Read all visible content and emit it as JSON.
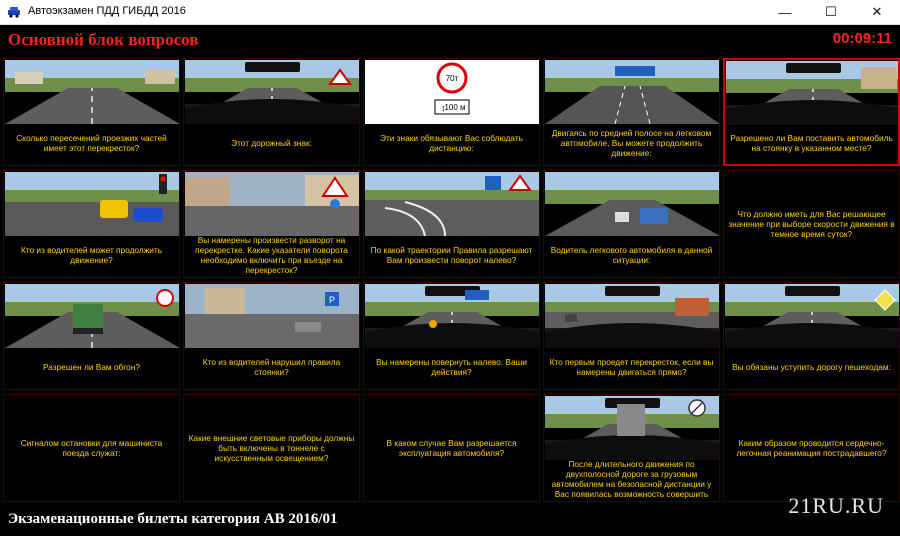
{
  "window": {
    "title": "Автоэкзамен ПДД ГИБДД 2016"
  },
  "header": {
    "title": "Основной блок вопросов",
    "timer": "00:09:11"
  },
  "questions": [
    {
      "text": "Сколько пересечений проезжих частей имеет этот перекресток?",
      "scene": "road"
    },
    {
      "text": "Этот дорожный знак:",
      "scene": "cockpit-sign"
    },
    {
      "text": "Эти знаки обязывают Вас соблюдать дистанцию:",
      "scene": "sign-70t",
      "sign_top": "70т",
      "sign_bottom": "100 м"
    },
    {
      "text": "Двигаясь по средней полосе на легковом автомобиле, Вы можете продолжить движение:",
      "scene": "lanes"
    },
    {
      "text": "Разрешено ли Вам поставить автомобиль на стоянку в указанном месте?",
      "scene": "cockpit-street",
      "active": true
    },
    {
      "text": "Кто из водителей может продолжить движение?",
      "scene": "intersection-cars"
    },
    {
      "text": "Вы намерены произвести разворот на перекрестке. Какие указатели поворота необходимо включить при въезде на перекресток?",
      "scene": "city-roundabout"
    },
    {
      "text": "По какой траектории Правила разрешают Вам произвести поворот налево?",
      "scene": "trajectory"
    },
    {
      "text": "Водитель легкового автомобиля в данной ситуации:",
      "scene": "highway-truck"
    },
    {
      "text": "Что должно иметь для Вас решающее значение при выборе скорости движения в темное время суток?",
      "scene": "none"
    },
    {
      "text": "Разрешен ли Вам обгон?",
      "scene": "truck-overtake"
    },
    {
      "text": "Кто из водителей нарушил правила стоянки?",
      "scene": "parking"
    },
    {
      "text": "Вы намерены повернуть налево. Ваши действия?",
      "scene": "cockpit-left"
    },
    {
      "text": "Кто первым проедет перекресток, если вы намерены двигаться прямо?",
      "scene": "cockpit-crossing"
    },
    {
      "text": "Вы обязаны уступить дорогу пешеходам:",
      "scene": "cockpit-ped"
    },
    {
      "text": "Сигналом остановки для машиниста поезда служат:",
      "scene": "none"
    },
    {
      "text": "Какие внешние световые приборы должны быть включены в тоннеле с искусственным освещением?",
      "scene": "none"
    },
    {
      "text": "В каком случае Вам разрешается эксплуатация автомобиля?",
      "scene": "none"
    },
    {
      "text": "После длительного движения по двухполосной дороге за грузовым автомобилем на безопасной дистанции у Вас появилась возможность совершить",
      "scene": "cockpit-truck"
    },
    {
      "text": "Каким образом проводится сердечно-легочная реанимация пострадавшего?",
      "scene": "none"
    }
  ],
  "footer": {
    "title": "Экзаменационные билеты категория АВ 2016/01",
    "watermark": "21RU.RU"
  },
  "colors": {
    "accent_red": "#ff2020",
    "question_text": "#ffd200",
    "active_border": "#d40000"
  }
}
